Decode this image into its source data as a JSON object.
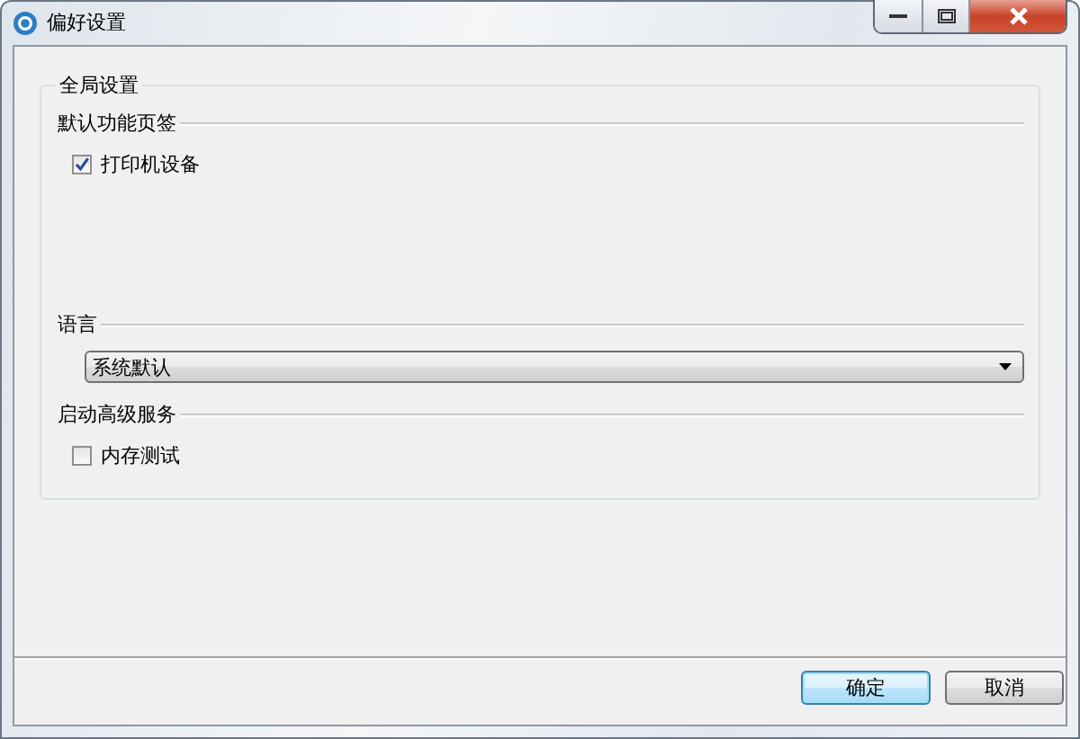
{
  "window": {
    "title": "偏好设置"
  },
  "group": {
    "title": "全局设置",
    "sections": [
      {
        "title": "默认功能页签",
        "kind": "checkbox",
        "checkbox": {
          "label": "打印机设备",
          "checked": true
        }
      },
      {
        "title": "语言",
        "kind": "select",
        "select": {
          "value": "系统默认"
        }
      },
      {
        "title": "启动高级服务",
        "kind": "checkbox",
        "checkbox": {
          "label": "内存测试",
          "checked": false
        }
      }
    ]
  },
  "buttons": [
    {
      "label": "确定",
      "default": true
    },
    {
      "label": "取消",
      "default": false
    }
  ]
}
